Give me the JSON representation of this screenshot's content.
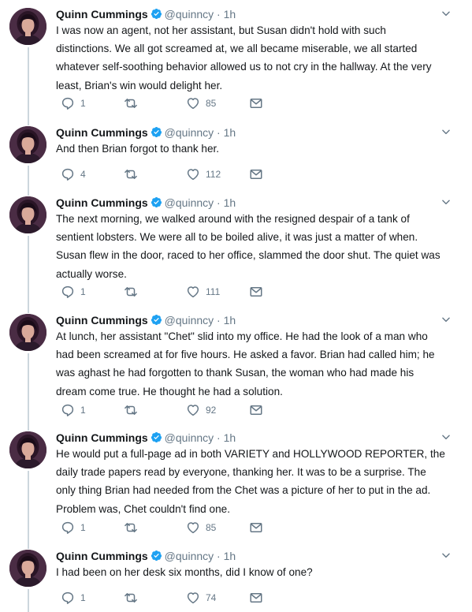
{
  "colors": {
    "text": "#14171a",
    "secondary": "#657786",
    "verified": "#1da1f2",
    "thread_line": "#ccd6dd"
  },
  "icons": {
    "verified": "verified-badge-icon",
    "caret": "chevron-down-icon",
    "reply": "reply-icon",
    "retweet": "retweet-icon",
    "like": "heart-icon",
    "dm": "envelope-icon"
  },
  "tweets": [
    {
      "name": "Quinn Cummings",
      "handle": "@quinncy",
      "dot": "·",
      "time": "1h",
      "lines": [
        "I was now an agent, not her assistant, but Susan didn't hold with such",
        "distinctions. We all got screamed at, we all became miserable, we all started",
        "whatever self-soothing behavior allowed us to not cry in the hallway. At the very",
        "least, Brian's win would delight her."
      ],
      "replies": "1",
      "retweets": "",
      "likes": "85"
    },
    {
      "name": "Quinn Cummings",
      "handle": "@quinncy",
      "dot": "·",
      "time": "1h",
      "lines": [
        "And then Brian forgot to thank her."
      ],
      "replies": "4",
      "retweets": "",
      "likes": "112"
    },
    {
      "name": "Quinn Cummings",
      "handle": "@quinncy",
      "dot": "·",
      "time": "1h",
      "lines": [
        "The next morning, we walked around with the resigned despair of a tank of",
        "sentient lobsters. We were all to be boiled alive, it was just a matter of when.",
        "Susan flew in the door, raced to her office, slammed the door shut. The quiet was",
        "actually worse."
      ],
      "replies": "1",
      "retweets": "",
      "likes": "111"
    },
    {
      "name": "Quinn Cummings",
      "handle": "@quinncy",
      "dot": "·",
      "time": "1h",
      "lines": [
        "At lunch, her assistant \"Chet\" slid into my office. He had the look of a man who",
        "had been screamed at for five hours. He asked a favor. Brian had called him; he",
        "was aghast he had forgotten to thank Susan, the woman who had made his",
        "dream come true. He thought he had a solution."
      ],
      "replies": "1",
      "retweets": "",
      "likes": "92"
    },
    {
      "name": "Quinn Cummings",
      "handle": "@quinncy",
      "dot": "·",
      "time": "1h",
      "lines": [
        "He would put a full-page ad in both VARIETY and HOLLYWOOD REPORTER, the",
        "daily trade papers read by everyone, thanking her. It was to be a surprise. The",
        "only thing Brian had needed from the Chet was a picture of her to put in the ad.",
        "Problem was, Chet couldn't find one."
      ],
      "replies": "1",
      "retweets": "",
      "likes": "85"
    },
    {
      "name": "Quinn Cummings",
      "handle": "@quinncy",
      "dot": "·",
      "time": "1h",
      "lines": [
        "I had been on her desk six months, did I know of one?"
      ],
      "replies": "1",
      "retweets": "",
      "likes": "74"
    }
  ]
}
